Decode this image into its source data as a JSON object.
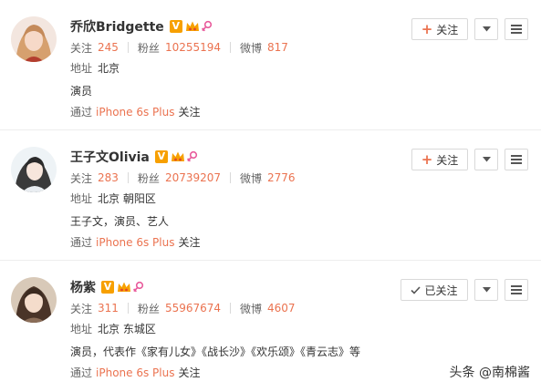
{
  "cards": [
    {
      "name": "乔欣Bridgette",
      "stats": [
        {
          "label": "关注",
          "value": "245"
        },
        {
          "label": "粉丝",
          "value": "10255194"
        },
        {
          "label": "微博",
          "value": "817"
        }
      ],
      "address_label": "地址",
      "address": "北京",
      "bio": "演员",
      "via_label": "通过",
      "via_device": "iPhone 6s Plus",
      "via_suffix": "关注",
      "follow_label": "关注",
      "followed": false
    },
    {
      "name": "王子文Olivia",
      "stats": [
        {
          "label": "关注",
          "value": "283"
        },
        {
          "label": "粉丝",
          "value": "20739207"
        },
        {
          "label": "微博",
          "value": "2776"
        }
      ],
      "address_label": "地址",
      "address": "北京 朝阳区",
      "bio": "王子文，演员、艺人",
      "via_label": "通过",
      "via_device": "iPhone 6s Plus",
      "via_suffix": "关注",
      "follow_label": "关注",
      "followed": false
    },
    {
      "name": "杨紫",
      "stats": [
        {
          "label": "关注",
          "value": "311"
        },
        {
          "label": "粉丝",
          "value": "55967674"
        },
        {
          "label": "微博",
          "value": "4607"
        }
      ],
      "address_label": "地址",
      "address": "北京 东城区",
      "bio": "演员，代表作《家有儿女》《战长沙》《欢乐颂》《青云志》等",
      "via_label": "通过",
      "via_device": "iPhone 6s Plus",
      "via_suffix": "关注",
      "follow_label": "已关注",
      "followed": true
    }
  ],
  "verified_badge": "V",
  "watermark": "头条 @南棉酱",
  "colors": {
    "accent": "#eb7350",
    "verified": "#f7a000",
    "crown": "#f7a000",
    "female": "#e85a9b",
    "divider": "#eeeeee",
    "border": "#d9d9d9"
  },
  "icons": [
    "verified-icon",
    "vip-crown-icon",
    "female-icon",
    "plus-icon",
    "check-icon",
    "chevron-down-icon",
    "menu-icon"
  ]
}
